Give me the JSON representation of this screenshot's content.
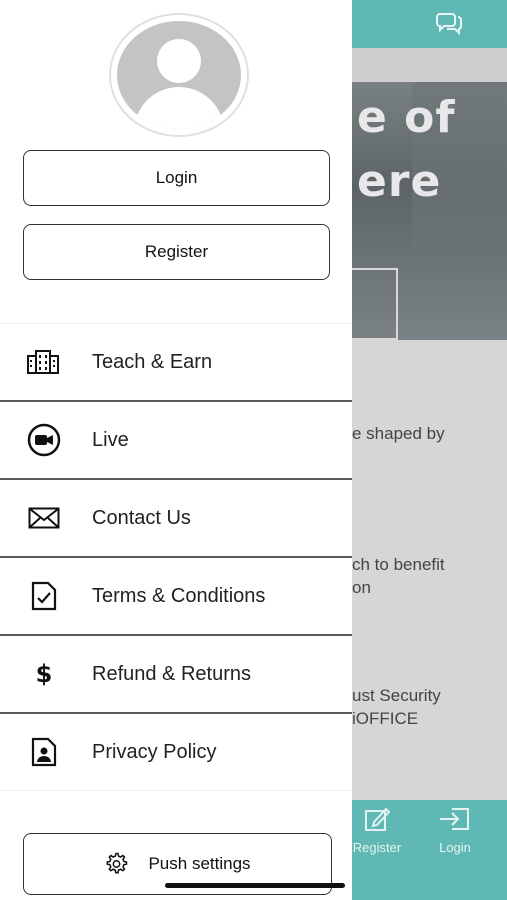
{
  "drawer": {
    "buttons": {
      "login": "Login",
      "register": "Register"
    },
    "menu": [
      {
        "label": "Teach & Earn",
        "icon": "building-icon"
      },
      {
        "label": "Live",
        "icon": "video-camera-icon"
      },
      {
        "label": "Contact Us",
        "icon": "envelope-icon"
      },
      {
        "label": "Terms & Conditions",
        "icon": "document-check-icon"
      },
      {
        "label": "Refund & Returns",
        "icon": "dollar-icon"
      },
      {
        "label": "Privacy Policy",
        "icon": "user-document-icon"
      }
    ],
    "push_settings": "Push settings"
  },
  "background": {
    "hero_line1": "e of",
    "hero_line2": "ere",
    "text1": "e shaped by",
    "text2a": "ch to benefit",
    "text2b": "on",
    "text3a": "ust Security",
    "text3b": "iOFFICE",
    "tabs": {
      "register": "Register",
      "login": "Login"
    },
    "accent_color": "#5fb8b3"
  }
}
